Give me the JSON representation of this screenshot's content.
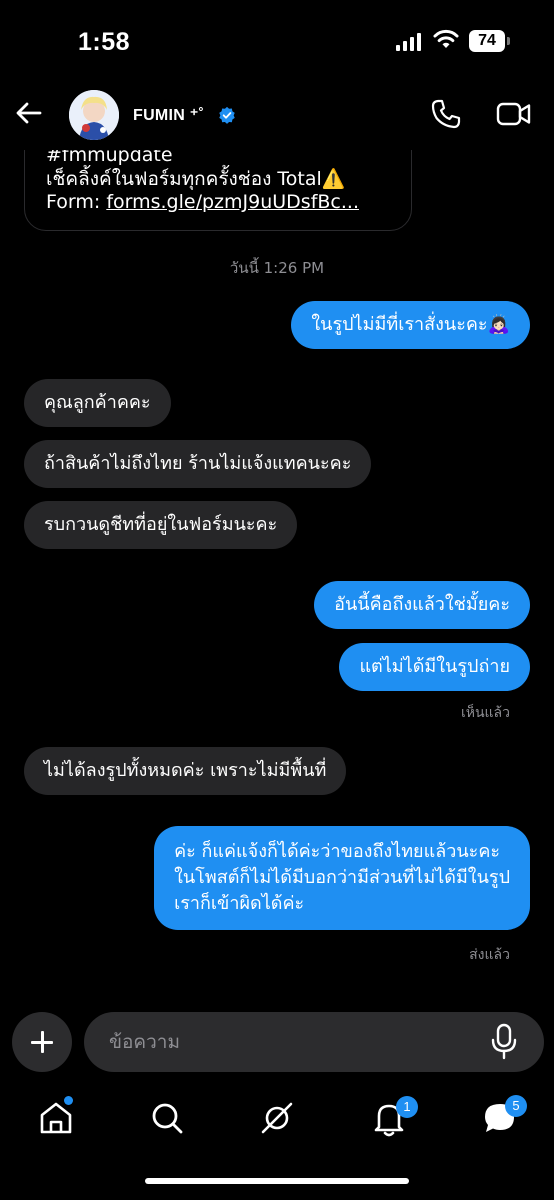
{
  "status_bar": {
    "time": "1:58",
    "battery": "74"
  },
  "header": {
    "name": "FUMIN ⁺˚",
    "back_icon": "back-arrow-icon",
    "call_icon": "phone-icon",
    "video_icon": "video-camera-icon"
  },
  "shared_post": {
    "line1": "#fmmupdate",
    "line2": "เช็คลิ้งค์ในฟอร์มทุกครั้งช่อง Total⚠️",
    "line3_prefix": "Form: ",
    "line3_link": "forms.gle/pzmJ9uUDsfBc..."
  },
  "date_separator": "วันนี้ 1:26 PM",
  "messages": [
    {
      "side": "out",
      "text": "ในรูปไม่มีที่เราสั่งนะคะ🙇🏻‍♀️"
    },
    {
      "side": "in",
      "text": "คุณลูกค้าคคะ"
    },
    {
      "side": "in",
      "text": "ถ้าสินค้าไม่ถึงไทย ร้านไม่แจ้งแทคนะคะ"
    },
    {
      "side": "in",
      "text": "รบกวนดูชีทที่อยู่ในฟอร์มนะคะ"
    },
    {
      "side": "out",
      "text": "อันนี้คือถึงแล้วใช่มั้ยคะ"
    },
    {
      "side": "out",
      "text": "แต่ไม่ได้มีในรูปถ่าย"
    },
    {
      "side": "in",
      "text": "ไม่ได้ลงรูปทั้งหมดค่ะ เพราะไม่มีพื้นที่"
    },
    {
      "side": "out",
      "lines": [
        "ค่ะ ก็แค่แจ้งก็ได้ค่ะว่าของถึงไทยแล้วนะคะ",
        "ในโพสต์ก็ไม่ได้มีบอกว่ามีส่วนที่ไม่ได้มีในรูป",
        "เราก็เข้าผิดได้ค่ะ"
      ]
    }
  ],
  "seen_label": "เห็นแล้ว",
  "sent_label": "ส่งแล้ว",
  "composer": {
    "placeholder": "ข้อความ"
  },
  "tabbar": {
    "notifications_badge": "1",
    "messages_badge": "5"
  },
  "colors": {
    "outgoing": "#1f8ff2",
    "incoming": "#262628",
    "accent": "#1f8ff2"
  }
}
